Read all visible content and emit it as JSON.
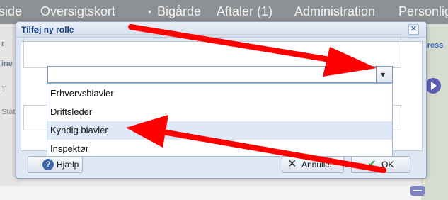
{
  "nav": {
    "items": [
      "side",
      "Oversigtskort",
      "Bigårde",
      "Aftaler (1)",
      "Administration",
      "Personlig"
    ],
    "dropdown_marker": "▾"
  },
  "background": {
    "left_labels": [
      "r",
      "ine",
      "T",
      "Stat"
    ],
    "map_label": "dress"
  },
  "dialog": {
    "title": "Tilføj ny rolle",
    "close_glyph": "✕",
    "combo": {
      "value": "",
      "trigger_glyph": "▾"
    },
    "options": [
      "Erhvervsbiavler",
      "Driftsleder",
      "Kyndig biavler",
      "Inspektør"
    ],
    "highlighted_option": "Kyndig biavler",
    "buttons": {
      "help": "Hjælp",
      "cancel": "Annullér",
      "ok": "OK"
    }
  },
  "colors": {
    "nav_bg": "#8e9193",
    "dialog_title": "#15428b",
    "arrow": "#ff0000",
    "highlight": "#dfe8f6"
  },
  "icons": [
    "close-icon",
    "chevron-down-icon",
    "help-icon",
    "cancel-x-icon",
    "checkmark-icon"
  ]
}
